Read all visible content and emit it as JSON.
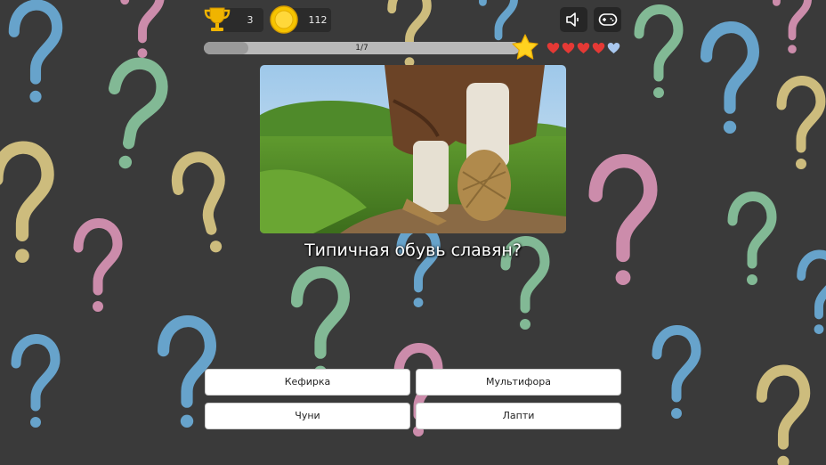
{
  "stats": {
    "trophies": "3",
    "coins": "112"
  },
  "progress": {
    "text": "1/7",
    "fraction": 0.14
  },
  "lives": {
    "full": 4,
    "empty": 1
  },
  "question": {
    "text": "Типичная обувь славян?"
  },
  "answers": [
    "Кефирка",
    "Мультифора",
    "Чуни",
    "Лапти"
  ],
  "icons": {
    "sound": "speaker-muted-icon",
    "games": "gamepad-icon",
    "trophy": "trophy-icon",
    "coin": "coin-icon",
    "star": "star-icon",
    "life": "heart-icon"
  },
  "colors": {
    "background": "#3a3a3a",
    "chalk_blue": "#6fb6e6",
    "chalk_pink": "#e79bc0",
    "chalk_yellow": "#e8d48a",
    "chalk_green": "#8fd0a6",
    "heart_full": "#e53935",
    "heart_empty": "#a9c8ef",
    "star": "#ffd21f"
  }
}
